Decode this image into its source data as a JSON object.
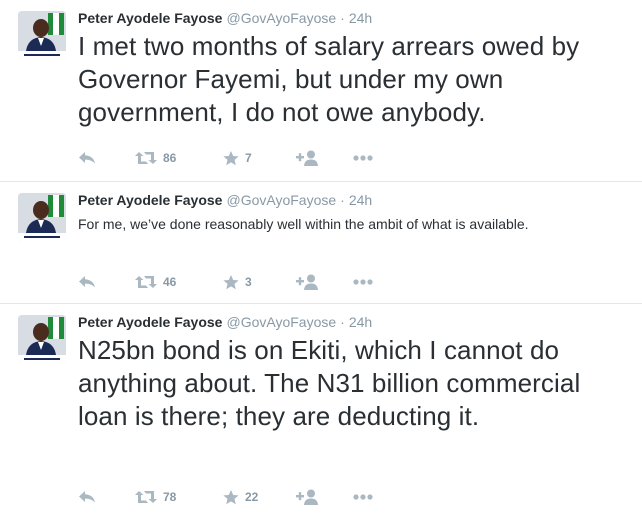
{
  "accent": "#55acee",
  "muted_color": "#8899a6",
  "icon_color": "#aab8c2",
  "tweets": [
    {
      "fullname": "Peter Ayodele Fayose",
      "handle": "@GovAyoFayose",
      "separator": "·",
      "time": "24h",
      "text": "I met two months of salary arrears owed by Governor Fayemi, but under my own government, I do not owe anybody.",
      "retweets": "86",
      "favorites": "7"
    },
    {
      "fullname": "Peter Ayodele Fayose",
      "handle": "@GovAyoFayose",
      "separator": "·",
      "time": "24h",
      "text": "For me, we’ve done reasonably well within the ambit of what is available.",
      "retweets": "46",
      "favorites": "3"
    },
    {
      "fullname": "Peter Ayodele Fayose",
      "handle": "@GovAyoFayose",
      "separator": "·",
      "time": "24h",
      "text": "N25bn bond is on Ekiti, which I cannot do anything about. The N31 billion commercial loan is there; they are deducting it.",
      "retweets": "78",
      "favorites": "22"
    }
  ],
  "icons": {
    "avatar": "profile-photo",
    "reply": "reply-icon",
    "retweet": "retweet-icon",
    "favorite": "star-icon",
    "follow": "follow-icon",
    "more": "more-icon"
  }
}
